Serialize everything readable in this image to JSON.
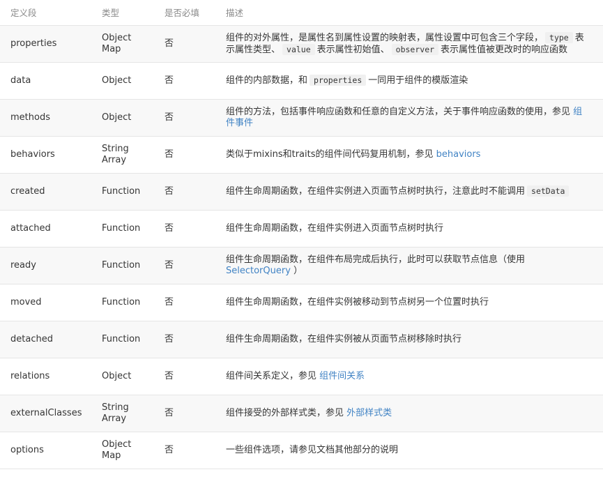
{
  "table": {
    "headers": [
      "定义段",
      "类型",
      "是否必填",
      "描述"
    ],
    "rows": [
      {
        "name": "properties",
        "type": [
          "Object",
          "Map"
        ],
        "required": "否",
        "desc": [
          {
            "t": "text",
            "v": "组件的对外属性，是属性名到属性设置的映射表，属性设置中可包含三个字段，"
          },
          {
            "t": "code",
            "v": "type"
          },
          {
            "t": "text",
            "v": "表示属性类型、"
          },
          {
            "t": "code",
            "v": "value"
          },
          {
            "t": "text",
            "v": "表示属性初始值、"
          },
          {
            "t": "code",
            "v": "observer"
          },
          {
            "t": "text",
            "v": "表示属性值被更改时的响应函数"
          }
        ]
      },
      {
        "name": "data",
        "type": [
          "Object"
        ],
        "required": "否",
        "desc": [
          {
            "t": "text",
            "v": "组件的内部数据，和"
          },
          {
            "t": "code",
            "v": "properties"
          },
          {
            "t": "text",
            "v": "一同用于组件的模版渲染"
          }
        ]
      },
      {
        "name": "methods",
        "type": [
          "Object"
        ],
        "required": "否",
        "desc": [
          {
            "t": "text",
            "v": "组件的方法，包括事件响应函数和任意的自定义方法，关于事件响应函数的使用，参见 "
          },
          {
            "t": "link",
            "v": "组件事件"
          }
        ]
      },
      {
        "name": "behaviors",
        "type": [
          "String",
          "Array"
        ],
        "required": "否",
        "desc": [
          {
            "t": "text",
            "v": "类似于mixins和traits的组件间代码复用机制，参见 "
          },
          {
            "t": "link",
            "v": "behaviors"
          }
        ]
      },
      {
        "name": "created",
        "type": [
          "Function"
        ],
        "required": "否",
        "desc": [
          {
            "t": "text",
            "v": "组件生命周期函数，在组件实例进入页面节点树时执行，注意此时不能调用"
          },
          {
            "t": "code",
            "v": "setData"
          }
        ]
      },
      {
        "name": "attached",
        "type": [
          "Function"
        ],
        "required": "否",
        "desc": [
          {
            "t": "text",
            "v": "组件生命周期函数，在组件实例进入页面节点树时执行"
          }
        ]
      },
      {
        "name": "ready",
        "type": [
          "Function"
        ],
        "required": "否",
        "desc": [
          {
            "t": "text",
            "v": "组件生命周期函数，在组件布局完成后执行，此时可以获取节点信息（使用 "
          },
          {
            "t": "link",
            "v": "SelectorQuery"
          },
          {
            "t": "text",
            "v": " ）"
          }
        ]
      },
      {
        "name": "moved",
        "type": [
          "Function"
        ],
        "required": "否",
        "desc": [
          {
            "t": "text",
            "v": "组件生命周期函数，在组件实例被移动到节点树另一个位置时执行"
          }
        ]
      },
      {
        "name": "detached",
        "type": [
          "Function"
        ],
        "required": "否",
        "desc": [
          {
            "t": "text",
            "v": "组件生命周期函数，在组件实例被从页面节点树移除时执行"
          }
        ]
      },
      {
        "name": "relations",
        "type": [
          "Object"
        ],
        "required": "否",
        "desc": [
          {
            "t": "text",
            "v": "组件间关系定义，参见 "
          },
          {
            "t": "link",
            "v": "组件间关系"
          }
        ]
      },
      {
        "name": "externalClasses",
        "type": [
          "String",
          "Array"
        ],
        "required": "否",
        "desc": [
          {
            "t": "text",
            "v": "组件接受的外部样式类，参见 "
          },
          {
            "t": "link",
            "v": "外部样式类"
          }
        ]
      },
      {
        "name": "options",
        "type": [
          "Object",
          "Map"
        ],
        "required": "否",
        "desc": [
          {
            "t": "text",
            "v": "一些组件选项，请参见文档其他部分的说明"
          }
        ]
      }
    ]
  },
  "colors": {
    "link": "#4183c4",
    "header_text": "#8a8a8a",
    "row_alt": "#f8f8f8",
    "border": "#e5e5e5"
  }
}
